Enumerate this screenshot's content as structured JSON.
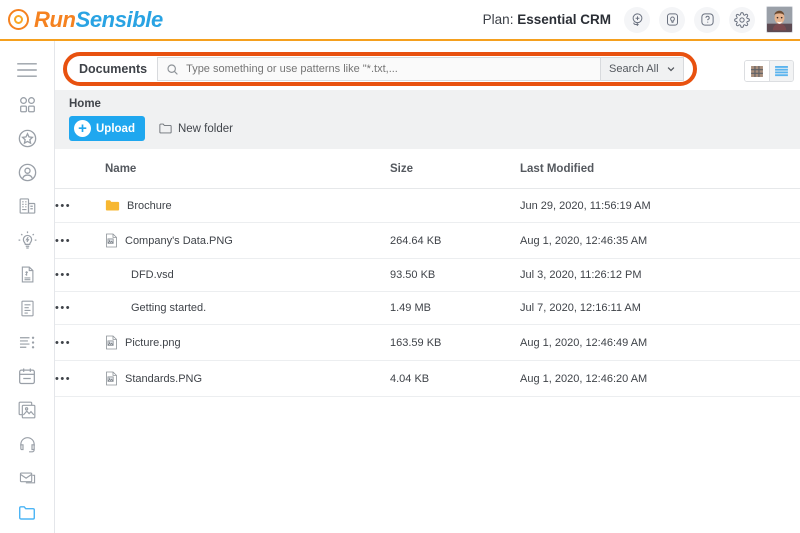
{
  "header": {
    "logo": {
      "part1": "Run",
      "part2": "Sensible",
      "icon": "runsensible-spiral-icon"
    },
    "plan_label": "Plan:",
    "plan_value": "Essential CRM",
    "icons": [
      {
        "name": "add-record-icon",
        "title": "Add"
      },
      {
        "name": "notification-bell-icon",
        "title": "Notifications"
      },
      {
        "name": "help-question-icon",
        "title": "Help"
      },
      {
        "name": "settings-gear-icon",
        "title": "Settings"
      }
    ],
    "avatar": {
      "name": "user-avatar",
      "alt": "User profile photo"
    }
  },
  "sidebar": {
    "items": [
      {
        "name": "sidebar-item-menu",
        "icon": "hamburger-menu-icon",
        "active": false
      },
      {
        "name": "sidebar-item-apps",
        "icon": "apps-grid-icon",
        "active": false
      },
      {
        "name": "sidebar-item-favorites",
        "icon": "star-badge-icon",
        "active": false
      },
      {
        "name": "sidebar-item-contacts",
        "icon": "user-circle-icon",
        "active": false
      },
      {
        "name": "sidebar-item-companies",
        "icon": "building-icon",
        "active": false
      },
      {
        "name": "sidebar-item-opportunities",
        "icon": "lightbulb-icon",
        "active": false
      },
      {
        "name": "sidebar-item-invoices",
        "icon": "document-dollar-icon",
        "active": false
      },
      {
        "name": "sidebar-item-forms",
        "icon": "form-icon",
        "active": false
      },
      {
        "name": "sidebar-item-tasks",
        "icon": "task-list-icon",
        "active": false
      },
      {
        "name": "sidebar-item-calendar",
        "icon": "calendar-icon",
        "active": false
      },
      {
        "name": "sidebar-item-library",
        "icon": "image-stack-icon",
        "active": false
      },
      {
        "name": "sidebar-item-support",
        "icon": "headset-icon",
        "active": false
      },
      {
        "name": "sidebar-item-mail",
        "icon": "envelope-icon",
        "active": false
      },
      {
        "name": "sidebar-item-documents",
        "icon": "folder-icon",
        "active": true
      }
    ]
  },
  "search": {
    "label": "Documents",
    "placeholder": "Type something or use patterns like \"*.txt,...",
    "value": "",
    "scope_selected": "Search All",
    "search_icon": "search-icon",
    "caret_icon": "chevron-down-icon",
    "highlight_color": "#e8510f"
  },
  "view_toggle": {
    "grid_label": "grid-view",
    "list_label": "list-view",
    "selected": "grid"
  },
  "toolbar": {
    "breadcrumb": "Home",
    "upload_label": "Upload",
    "upload_plus": "+",
    "new_folder_label": "New folder",
    "upload_color": "#1fa7ef"
  },
  "table": {
    "columns": [
      "Name",
      "Size",
      "Last Modified"
    ],
    "row_menu_glyph": "•••",
    "rows": [
      {
        "icon": "folder-icon",
        "type": "folder",
        "name": "Brochure",
        "size": "",
        "modified": "Jun 29, 2020, 11:56:19 AM"
      },
      {
        "icon": "image-file-icon",
        "type": "image",
        "name": "Company's Data.PNG",
        "size": "264.64 KB",
        "modified": "Aug 1, 2020, 12:46:35 AM"
      },
      {
        "icon": "none",
        "type": "file",
        "name": "DFD.vsd",
        "size": "93.50 KB",
        "modified": "Jul 3, 2020, 11:26:12 PM"
      },
      {
        "icon": "none",
        "type": "file",
        "name": "Getting started.",
        "size": "1.49 MB",
        "modified": "Jul 7, 2020, 12:16:11 AM"
      },
      {
        "icon": "image-file-icon",
        "type": "image",
        "name": "Picture.png",
        "size": "163.59 KB",
        "modified": "Aug 1, 2020, 12:46:49 AM"
      },
      {
        "icon": "image-file-icon",
        "type": "image",
        "name": "Standards.PNG",
        "size": "4.04 KB",
        "modified": "Aug 1, 2020, 12:46:20 AM"
      }
    ]
  }
}
